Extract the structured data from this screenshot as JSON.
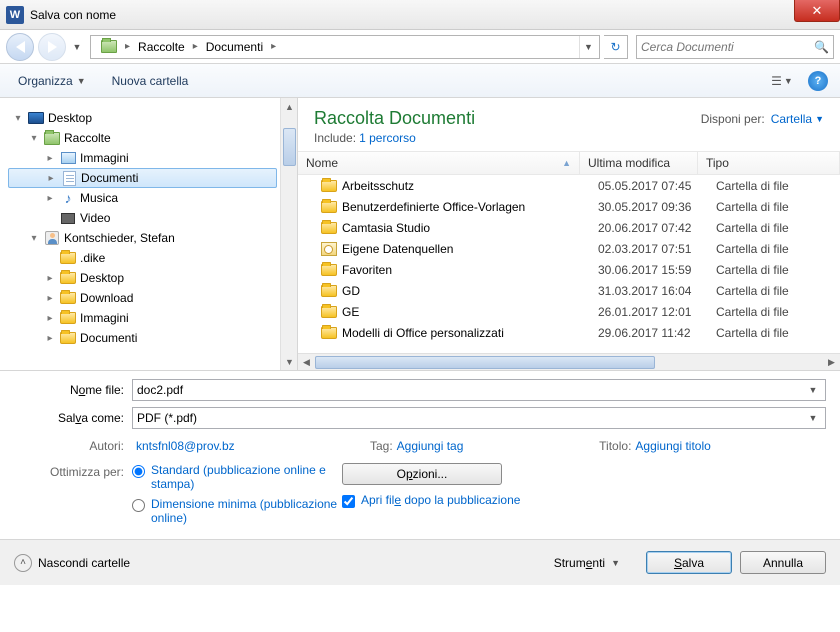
{
  "title": "Salva con nome",
  "nav": {
    "crumbs": [
      "Raccolte",
      "Documenti"
    ],
    "search_placeholder": "Cerca Documenti"
  },
  "toolbar": {
    "organize": "Organizza",
    "new_folder": "Nuova cartella"
  },
  "tree": [
    {
      "label": "Desktop",
      "depth": 0,
      "icon": "desktop",
      "exp": "▾"
    },
    {
      "label": "Raccolte",
      "depth": 1,
      "icon": "lib",
      "exp": "▾"
    },
    {
      "label": "Immagini",
      "depth": 2,
      "icon": "pic",
      "exp": "▸"
    },
    {
      "label": "Documenti",
      "depth": 2,
      "icon": "doc",
      "exp": "▸",
      "selected": true
    },
    {
      "label": "Musica",
      "depth": 2,
      "icon": "music",
      "exp": "▸"
    },
    {
      "label": "Video",
      "depth": 2,
      "icon": "video",
      "exp": ""
    },
    {
      "label": "Kontschieder, Stefan",
      "depth": 1,
      "icon": "user",
      "exp": "▾"
    },
    {
      "label": ".dike",
      "depth": 2,
      "icon": "folder",
      "exp": ""
    },
    {
      "label": "Desktop",
      "depth": 2,
      "icon": "folder",
      "exp": "▸"
    },
    {
      "label": "Download",
      "depth": 2,
      "icon": "folder",
      "exp": "▸"
    },
    {
      "label": "Immagini",
      "depth": 2,
      "icon": "folder",
      "exp": "▸"
    },
    {
      "label": "Documenti",
      "depth": 2,
      "icon": "folder",
      "exp": "▸"
    }
  ],
  "library": {
    "heading": "Raccolta Documenti",
    "include_label": "Include:",
    "include_link": "1 percorso",
    "arrange_label": "Disponi per:",
    "arrange_value": "Cartella"
  },
  "columns": {
    "name": "Nome",
    "date": "Ultima modifica",
    "type": "Tipo"
  },
  "files": [
    {
      "name": "Arbeitsschutz",
      "date": "05.05.2017 07:45",
      "type": "Cartella di file",
      "icon": "folder"
    },
    {
      "name": "Benutzerdefinierte Office-Vorlagen",
      "date": "30.05.2017 09:36",
      "type": "Cartella di file",
      "icon": "folder"
    },
    {
      "name": "Camtasia Studio",
      "date": "20.06.2017 07:42",
      "type": "Cartella di file",
      "icon": "folder"
    },
    {
      "name": "Eigene Datenquellen",
      "date": "02.03.2017 07:51",
      "type": "Cartella di file",
      "icon": "db"
    },
    {
      "name": "Favoriten",
      "date": "30.06.2017 15:59",
      "type": "Cartella di file",
      "icon": "folder"
    },
    {
      "name": "GD",
      "date": "31.03.2017 16:04",
      "type": "Cartella di file",
      "icon": "folder"
    },
    {
      "name": "GE",
      "date": "26.01.2017 12:01",
      "type": "Cartella di file",
      "icon": "folder"
    },
    {
      "name": "Modelli di Office personalizzati",
      "date": "29.06.2017 11:42",
      "type": "Cartella di file",
      "icon": "folder"
    }
  ],
  "form": {
    "filename_label_pre": "N",
    "filename_label_ul": "o",
    "filename_label_post": "me file:",
    "filename_value": "doc2.pdf",
    "saveas_label_pre": "Sal",
    "saveas_label_ul": "v",
    "saveas_label_post": "a come:",
    "saveas_value": "PDF (*.pdf)",
    "authors_label": "Autori:",
    "authors_value": "kntsfnl08@prov.bz",
    "tag_label": "Tag:",
    "tag_value": "Aggiungi tag",
    "title_label": "Titolo:",
    "title_value": "Aggiungi titolo",
    "optimize_label": "Ottimizza per:",
    "radio_standard": "Standard (pubblicazione online e stampa)",
    "radio_min": "Dimensione minima (pubblicazione online)",
    "options_btn_pre": "O",
    "options_btn_ul": "p",
    "options_btn_post": "zioni...",
    "open_after_pre": "Apri fil",
    "open_after_ul": "e",
    "open_after_post": " dopo la pubblicazione"
  },
  "footer": {
    "hide": "Nascondi cartelle",
    "tools_pre": "Strum",
    "tools_ul": "e",
    "tools_post": "nti",
    "save_pre": "",
    "save_ul": "S",
    "save_post": "alva",
    "cancel": "Annulla"
  }
}
